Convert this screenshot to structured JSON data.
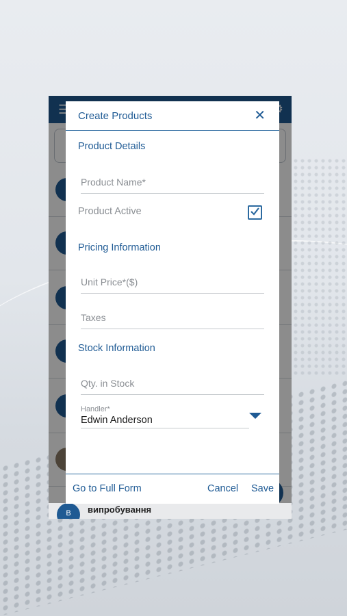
{
  "app_list": {
    "last_item": {
      "avatar_letter": "В",
      "title": "випробування"
    }
  },
  "dialog": {
    "title": "Create Products",
    "close_icon": "close-icon",
    "sections": {
      "product_details": "Product Details",
      "pricing_information": "Pricing Information",
      "stock_information": "Stock Information"
    },
    "fields": {
      "product_name_placeholder": "Product Name*",
      "product_name_value": "",
      "unit_price_placeholder": "Unit Price*($)",
      "unit_price_value": "",
      "taxes_placeholder": "Taxes",
      "taxes_value": "",
      "qty_placeholder": "Qty. in Stock",
      "qty_value": ""
    },
    "product_active": {
      "label": "Product Active",
      "checked": true
    },
    "handler": {
      "label": "Handler*",
      "value": "Edwin Anderson"
    },
    "footer": {
      "full_form": "Go to Full Form",
      "cancel": "Cancel",
      "save": "Save"
    }
  },
  "colors": {
    "accent": "#1e5a94",
    "header": "#1f5a93"
  }
}
